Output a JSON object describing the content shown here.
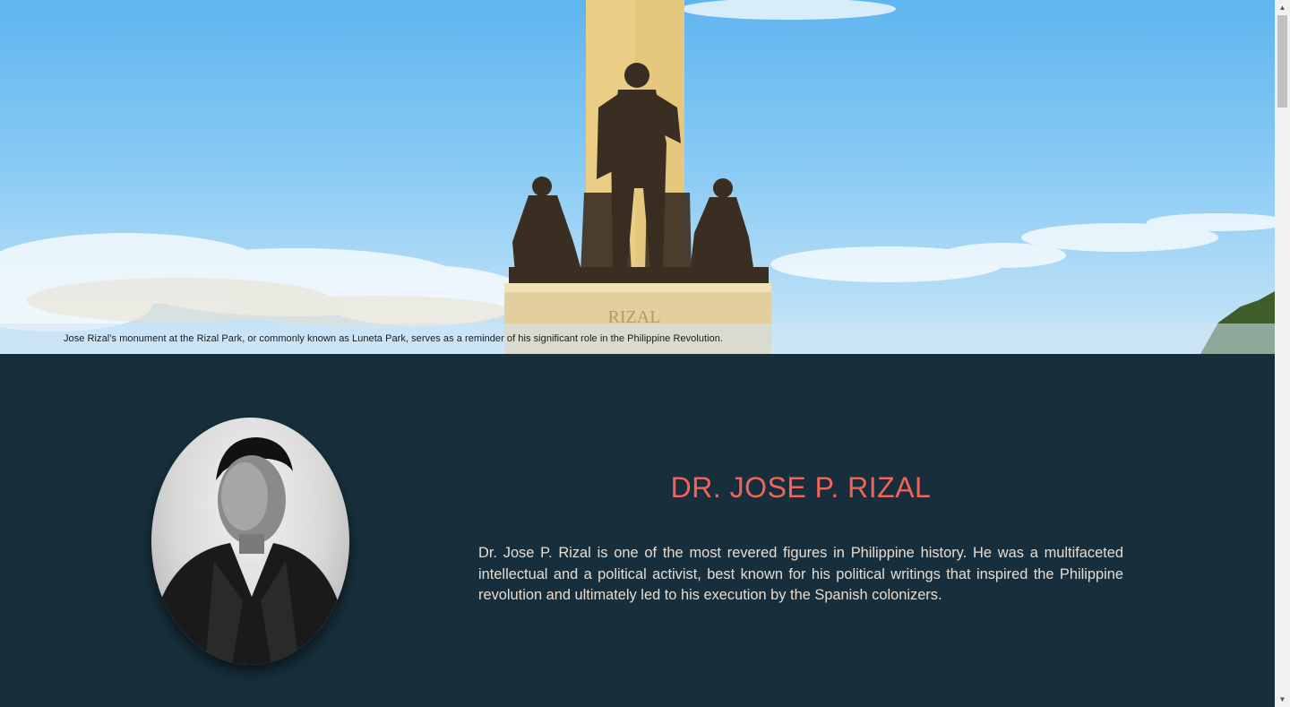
{
  "hero": {
    "monument_inscription": "RIZAL",
    "caption": "Jose Rizal’s monument at the Rizal Park, or commonly known as Luneta Park, serves as a reminder of his significant role in the Philippine Revolution."
  },
  "bio": {
    "title": "DR. JOSE P. RIZAL",
    "text": "Dr. Jose P. Rizal is one of the most revered figures in Philippine history. He was a multifaceted intellectual and a political activist, best known for his political writings that inspired the Philippine revolution and ultimately led to his execution by the Spanish colonizers."
  },
  "scrollbar": {
    "up_icon": "arrow-up-icon",
    "down_icon": "arrow-down-icon"
  },
  "colors": {
    "section_bg": "#172f3c",
    "title": "#f16457",
    "body_text": "#e8dccf"
  }
}
